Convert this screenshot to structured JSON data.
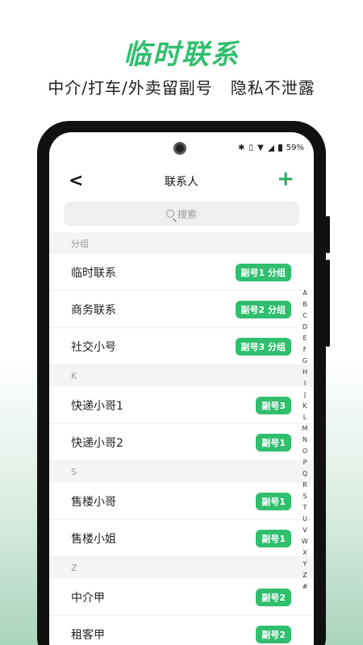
{
  "promo": {
    "title": "临时联系",
    "subtitle": "中介/打车/外卖留副号   隐私不泄露"
  },
  "status_bar": {
    "icons": [
      "bluetooth-icon",
      "vibrate-icon",
      "wifi-icon",
      "signal-icon",
      "battery-icon"
    ],
    "battery": "59%"
  },
  "nav": {
    "back": "<",
    "title": "联系人",
    "add": "+"
  },
  "search": {
    "placeholder": "搜索"
  },
  "sections": [
    {
      "header": "分组",
      "rows": [
        {
          "name": "临时联系",
          "tag": "副号1 分组"
        },
        {
          "name": "商务联系",
          "tag": "副号2 分组"
        },
        {
          "name": "社交小号",
          "tag": "副号3 分组"
        }
      ]
    },
    {
      "header": "K",
      "rows": [
        {
          "name": "快递小哥1",
          "tag": "副号3"
        },
        {
          "name": "快递小哥2",
          "tag": "副号1"
        }
      ]
    },
    {
      "header": "S",
      "rows": [
        {
          "name": "售楼小哥",
          "tag": "副号1"
        },
        {
          "name": "售楼小姐",
          "tag": "副号1"
        }
      ]
    },
    {
      "header": "Z",
      "rows": [
        {
          "name": "中介甲",
          "tag": "副号2"
        },
        {
          "name": "租客甲",
          "tag": "副号2"
        }
      ]
    }
  ],
  "alpha_index": [
    "A",
    "B",
    "C",
    "D",
    "E",
    "F",
    "G",
    "H",
    "I",
    "J",
    "K",
    "L",
    "M",
    "N",
    "O",
    "P",
    "Q",
    "R",
    "S",
    "T",
    "U",
    "V",
    "W",
    "X",
    "Y",
    "Z",
    "#"
  ],
  "colors": {
    "accent": "#2fbf6e",
    "add_icon": "#2fa862"
  }
}
